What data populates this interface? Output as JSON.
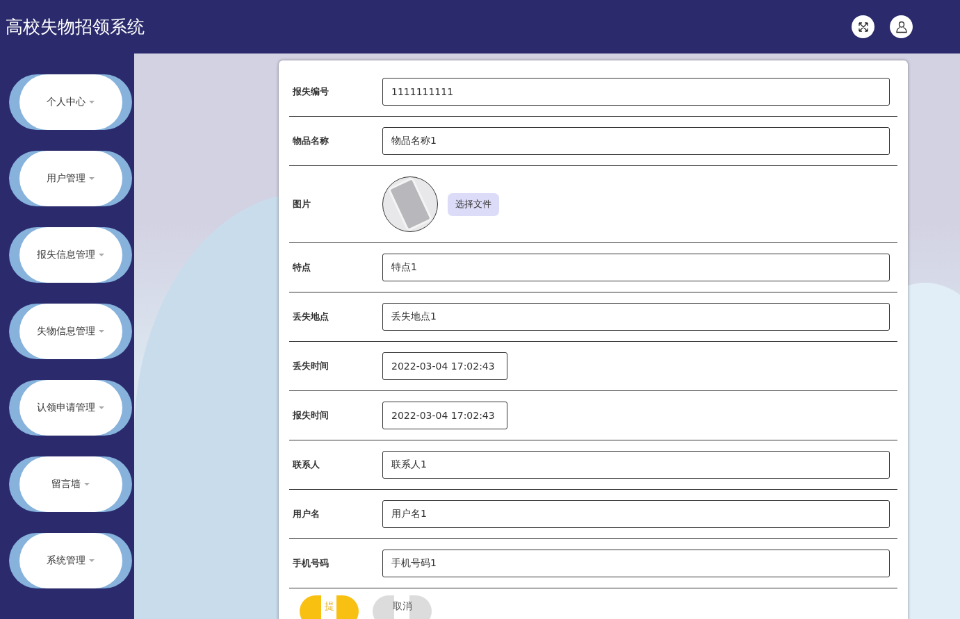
{
  "header": {
    "title": "高校失物招领系统"
  },
  "sidebar": {
    "items": [
      {
        "label": "个人中心"
      },
      {
        "label": "用户管理"
      },
      {
        "label": "报失信息管理"
      },
      {
        "label": "失物信息管理"
      },
      {
        "label": "认领申请管理"
      },
      {
        "label": "留言墙"
      },
      {
        "label": "系统管理"
      }
    ]
  },
  "form": {
    "fields": [
      {
        "kind": "text",
        "label": "报失编号",
        "value": "1111111111"
      },
      {
        "kind": "text",
        "label": "物品名称",
        "value": "物品名称1"
      },
      {
        "kind": "image",
        "label": "图片",
        "button": "选择文件"
      },
      {
        "kind": "text",
        "label": "特点",
        "value": "特点1"
      },
      {
        "kind": "text",
        "label": "丢失地点",
        "value": "丢失地点1"
      },
      {
        "kind": "date",
        "label": "丢失时间",
        "value": "2022-03-04 17:02:43"
      },
      {
        "kind": "date",
        "label": "报失时间",
        "value": "2022-03-04 17:02:43"
      },
      {
        "kind": "text",
        "label": "联系人",
        "value": "联系人1"
      },
      {
        "kind": "text",
        "label": "用户名",
        "value": "用户名1"
      },
      {
        "kind": "text",
        "label": "手机号码",
        "value": "手机号码1"
      }
    ],
    "buttons": [
      {
        "kind": "submit",
        "label": "提"
      },
      {
        "kind": "cancel",
        "label": "取消"
      }
    ]
  }
}
